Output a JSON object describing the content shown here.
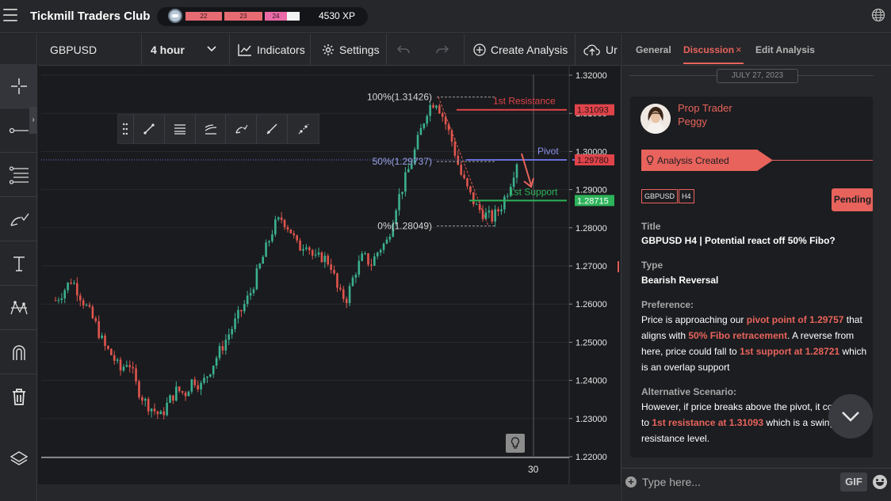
{
  "app": {
    "title": "Tickmill Traders Club",
    "xp": "4530 XP",
    "levels": [
      "22",
      "23",
      "24"
    ]
  },
  "toolbar": {
    "symbol": "GBPUSD",
    "timeframe": "4 hour",
    "indicators_label": "Indicators",
    "settings_label": "Settings",
    "create_label": "Create Analysis",
    "upload_label": "Ur"
  },
  "left_tools": [
    "crosshair-icon",
    "horizontal-line-icon",
    "fibonacci-icon",
    "brush-icon",
    "text-icon",
    "pattern-icon",
    "magnet-icon",
    "trash-icon",
    "layers-icon"
  ],
  "drawing_tools": [
    "drag-handle-icon",
    "trendline-icon",
    "lines-icon",
    "channel-icon",
    "brush-icon",
    "ray-icon",
    "extended-line-icon"
  ],
  "chart_data": {
    "type": "candlestick",
    "symbol": "GBPUSD",
    "timeframe": "4 hour",
    "y_ticks": [
      "1.32000",
      "1.31000",
      "1.30000",
      "1.29000",
      "1.28000",
      "1.27000",
      "1.26000",
      "1.25000",
      "1.24000",
      "1.23000",
      "1.22000"
    ],
    "ylim": [
      1.22,
      1.32
    ],
    "x_ticks": [
      "30"
    ],
    "fib_levels": [
      {
        "label": "100%(1.31426)",
        "value": 1.31426
      },
      {
        "label": "50%(1.29737)",
        "value": 1.29737
      },
      {
        "label": "0%(1.28049)",
        "value": 1.28049
      }
    ],
    "levels": [
      {
        "name": "1st Resistance",
        "value": 1.31093,
        "badge": "1.31093",
        "color": "#e0444a"
      },
      {
        "name": "Pivot",
        "value": 1.2978,
        "badge": "1.29780",
        "color": "#6a6fd8"
      },
      {
        "name": "1st Support",
        "value": 1.28715,
        "badge": "1.28715",
        "color": "#2db35a"
      }
    ],
    "price_path": [
      1.261,
      1.2635,
      1.2665,
      1.2625,
      1.2585,
      1.2545,
      1.249,
      1.2465,
      1.2425,
      1.2455,
      1.2385,
      1.2345,
      1.2325,
      1.2305,
      1.2345,
      1.2375,
      1.2365,
      1.2405,
      1.2385,
      1.2425,
      1.2465,
      1.2505,
      1.2545,
      1.2585,
      1.2625,
      1.2685,
      1.2745,
      1.2805,
      1.2825,
      1.2795,
      1.2745,
      1.2765,
      1.2715,
      1.2725,
      1.2705,
      1.2625,
      1.2615,
      1.2685,
      1.2725,
      1.2705,
      1.2745,
      1.2765,
      1.2855,
      1.2915,
      1.2975,
      1.3045,
      1.3115,
      1.3135,
      1.3085,
      1.3025,
      1.2945,
      1.2895,
      1.2855,
      1.2835,
      1.2825,
      1.2855,
      1.2905,
      1.2975
    ]
  },
  "panel": {
    "tabs": {
      "general": "General",
      "discussion": "Discussion",
      "edit": "Edit Analysis"
    },
    "date": "JULY 27, 2023",
    "role": "Prop Trader",
    "user": "Peggy",
    "banner": "Analysis Created",
    "tag_symbol": "GBPUSD",
    "tag_tf": "H4",
    "status": "Pending",
    "title_label": "Title",
    "title_value": "GBPUSD H4 | Potential react off 50% Fibo?",
    "type_label": "Type",
    "type_value": "Bearish Reversal",
    "pref_label": "Preference:",
    "pref_segments": [
      {
        "t": "Price is approaching our ",
        "hl": false
      },
      {
        "t": "pivot point of 1.29757",
        "hl": true
      },
      {
        "t": " that aligns with ",
        "hl": false
      },
      {
        "t": "50% Fibo retracement",
        "hl": true
      },
      {
        "t": ". A reverse from here, price could fall to ",
        "hl": false
      },
      {
        "t": "1st support at 1.28721",
        "hl": true
      },
      {
        "t": " which is an overlap support",
        "hl": false
      }
    ],
    "alt_label": "Alternative Scenario:",
    "alt_segments": [
      {
        "t": "However, if price breaks above the pivot, it could rise to ",
        "hl": false
      },
      {
        "t": "1st resistance at 1.31093",
        "hl": true
      },
      {
        "t": " which is a swing high resistance level.",
        "hl": false
      }
    ]
  },
  "composer": {
    "placeholder": "Type here...",
    "gif": "GIF"
  }
}
